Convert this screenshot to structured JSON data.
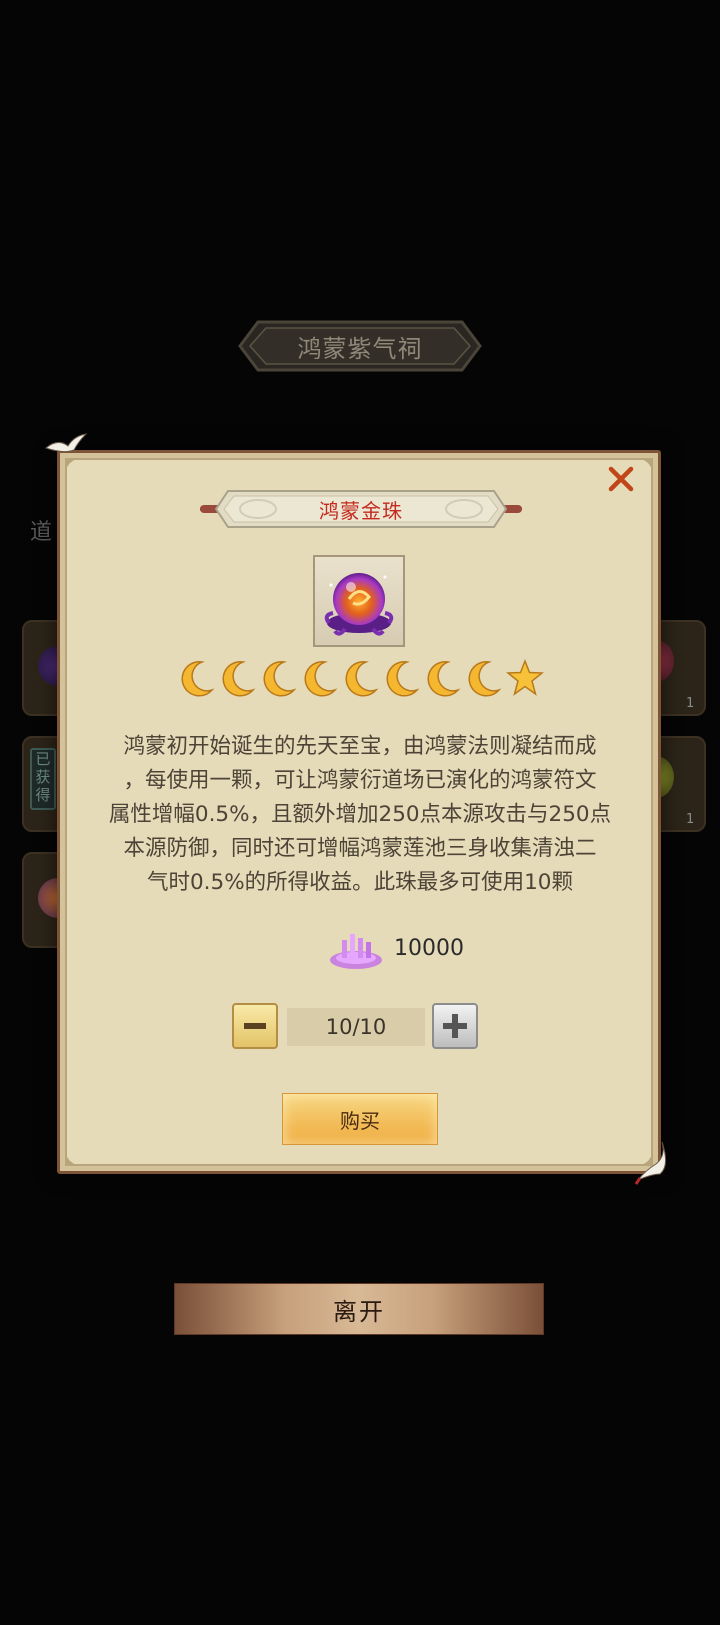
{
  "scene": {
    "title": "鸿蒙紫气祠",
    "side_label": "道",
    "obtained_badge": "已获得",
    "slot_counts": [
      "1",
      "1"
    ]
  },
  "dialog": {
    "item_name": "鸿蒙金珠",
    "close_icon": "close-x-icon",
    "item_icon": "purple-orb-icon",
    "rank": {
      "moons": 8,
      "stars": 1
    },
    "description": "鸿蒙初开始诞生的先天至宝，由鸿蒙法则凝结而成\n，每使用一颗，可让鸿蒙衍道场已演化的鸿蒙符文\n属性增幅0.5%，且额外增加250点本源攻击与250点\n本源防御，同时还可增幅鸿蒙莲池三身收集清浊二\n气时0.5%的所得收益。此珠最多可使用10颗",
    "price": {
      "currency_icon": "purple-crystal-icon",
      "amount": "10000"
    },
    "quantity": {
      "value": "10/10",
      "minus_icon": "minus-icon",
      "plus_icon": "plus-icon"
    },
    "buy_label": "购买"
  },
  "leave_label": "离开",
  "colors": {
    "panel": "#e6dbb9",
    "panel_border": "#7d5436",
    "title_red": "#c42a1e",
    "buy_gold": "#efaa3d"
  }
}
